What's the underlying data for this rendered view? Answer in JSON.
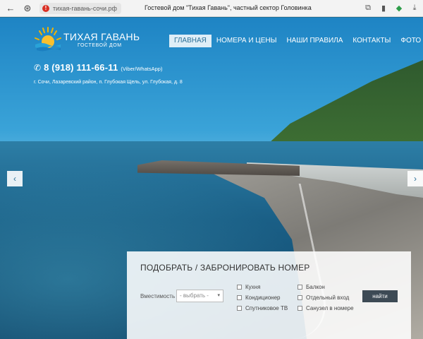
{
  "browser": {
    "url": "тихая-гавань-сочи.рф",
    "tab_title": "Гостевой дом \"Тихая Гавань\", частный сектор Головинка"
  },
  "logo": {
    "title": "ТИХАЯ ГАВАНЬ",
    "subtitle": "ГОСТЕВОЙ ДОМ"
  },
  "nav": {
    "items": [
      {
        "label": "ГЛАВНАЯ",
        "active": true
      },
      {
        "label": "НОМЕРА И ЦЕНЫ"
      },
      {
        "label": "НАШИ ПРАВИЛА"
      },
      {
        "label": "КОНТАКТЫ"
      },
      {
        "label": "ФОТО"
      }
    ]
  },
  "contact": {
    "phone": "8 (918) 111-66-11",
    "phone_note": "(Viber/WhatsApp)",
    "address": "г. Сочи, Лазаревский район, п. Глубокая Щель, ул. Глубокая, д. 8"
  },
  "booking": {
    "title": "ПОДОБРАТЬ / ЗАБРОНИРОВАТЬ НОМЕР",
    "capacity_label": "Вместимость",
    "capacity_value": "- выбрать -",
    "options": [
      "Кухня",
      "Балкон",
      "Кондиционер",
      "Отдельный вход",
      "Спутниковое ТВ",
      "Санузел в номере"
    ],
    "find_label": "найти"
  },
  "colors": {
    "accent": "#2a6f97",
    "button": "#3d4a55",
    "warning": "#d93025"
  }
}
